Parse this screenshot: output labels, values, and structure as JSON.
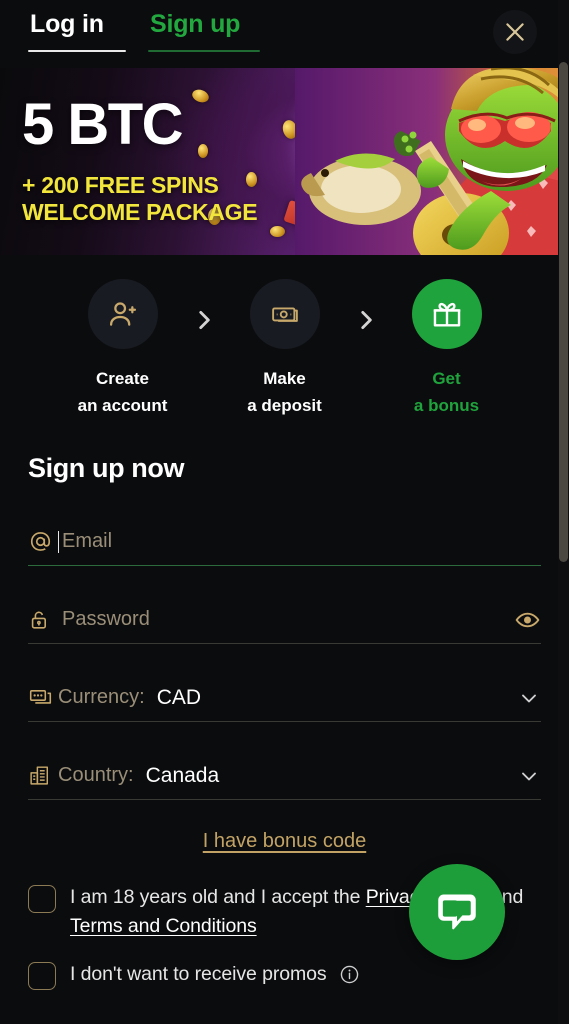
{
  "header": {
    "tabs": [
      {
        "label": "Log in",
        "active": false
      },
      {
        "label": "Sign up",
        "active": true
      }
    ],
    "close_label": "close-icon"
  },
  "banner": {
    "headline": "5 BTC",
    "sub_line1": "+ 200 FREE SPINS",
    "sub_line2": "WELCOME PACKAGE",
    "headline_color": "#ffffff",
    "sub_color": "#f2e63c"
  },
  "steps": [
    {
      "icon": "person-add-icon",
      "line1": "Create",
      "line2": "an account",
      "active": false
    },
    {
      "icon": "banknote-icon",
      "line1": "Make",
      "line2": "a deposit",
      "active": false
    },
    {
      "icon": "gift-icon",
      "line1": "Get",
      "line2": "a bonus",
      "active": true
    }
  ],
  "separator_icon": "chevron-right-icon",
  "form": {
    "title": "Sign up now",
    "email": {
      "icon": "at-sign-icon",
      "placeholder": "Email",
      "value": "",
      "focused": true
    },
    "password": {
      "icon": "lock-icon",
      "placeholder": "Password",
      "value": "",
      "toggle_icon": "eye-icon"
    },
    "currency": {
      "icon": "banknotes-icon",
      "label": "Currency:",
      "value": "CAD",
      "chevron": "chevron-down-icon"
    },
    "country": {
      "icon": "building-icon",
      "label": "Country:",
      "value": "Canada",
      "chevron": "chevron-down-icon"
    },
    "bonus_code_link": "I have bonus code",
    "consent": {
      "text_before": "I am 18 years old and I accept the ",
      "link1": "Privacy Policy",
      "text_middle": " and ",
      "link2": "Terms and Conditions",
      "text_after": ""
    },
    "promos": {
      "text": "I don't want to receive promos",
      "info_icon": "info-circle-icon"
    }
  },
  "chat": {
    "icon": "chat-bubble-icon",
    "color": "#1e9e3a"
  },
  "scrollbar": {
    "name": "page-scrollbar"
  },
  "colors": {
    "accent_green": "#1fa33c",
    "gold": "#c8a96b",
    "background": "#0b0c0e"
  }
}
